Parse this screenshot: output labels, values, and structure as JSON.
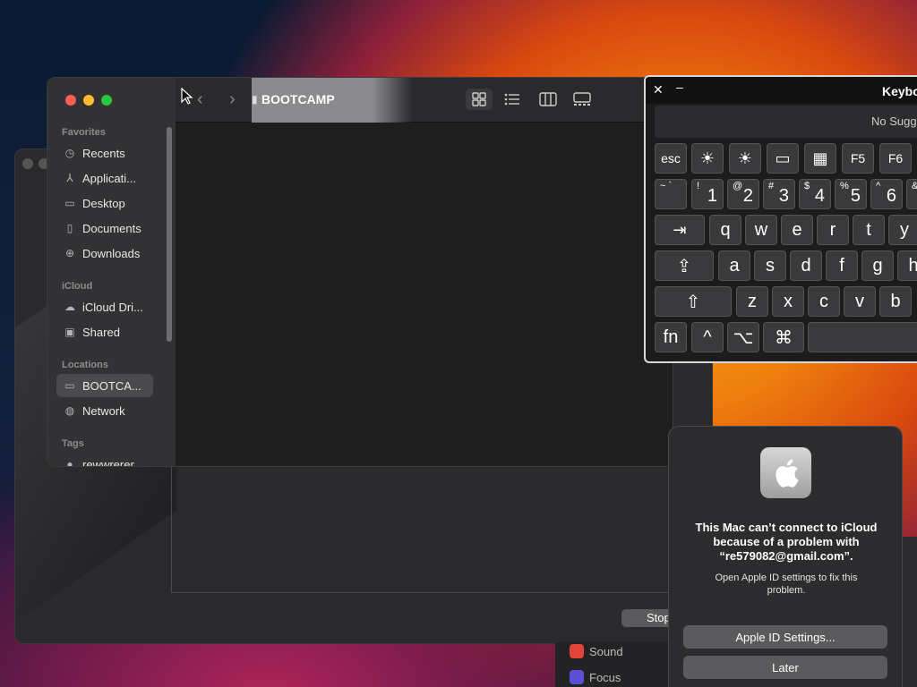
{
  "finder": {
    "title": "BOOTCAMP",
    "sidebar": {
      "favorites_label": "Favorites",
      "favorites": [
        {
          "label": "Recents",
          "icon": "clock-icon"
        },
        {
          "label": "Applicati...",
          "icon": "applications-icon"
        },
        {
          "label": "Desktop",
          "icon": "desktop-icon"
        },
        {
          "label": "Documents",
          "icon": "document-icon"
        },
        {
          "label": "Downloads",
          "icon": "download-icon"
        }
      ],
      "icloud_label": "iCloud",
      "icloud": [
        {
          "label": "iCloud Dri...",
          "icon": "cloud-icon"
        },
        {
          "label": "Shared",
          "icon": "shared-folder-icon"
        }
      ],
      "locations_label": "Locations",
      "locations": [
        {
          "label": "BOOTCA...",
          "icon": "drive-icon",
          "selected": true
        },
        {
          "label": "Network",
          "icon": "globe-icon"
        }
      ],
      "tags_label": "Tags",
      "tags": [
        {
          "label": "rewwrerer",
          "icon": "tag-dot-icon"
        }
      ]
    }
  },
  "keyboard": {
    "title": "Keybo",
    "suggestion": "No Sugge",
    "function_row": [
      "esc",
      "☀",
      "☀",
      "▭",
      "▦",
      "F5",
      "F6"
    ],
    "number_row": [
      {
        "sub": "~ `",
        "main": ""
      },
      {
        "sub": "!",
        "main": "1"
      },
      {
        "sub": "@",
        "main": "2"
      },
      {
        "sub": "#",
        "main": "3"
      },
      {
        "sub": "$",
        "main": "4"
      },
      {
        "sub": "%",
        "main": "5"
      },
      {
        "sub": "^",
        "main": "6"
      },
      {
        "sub": "&",
        "main": ""
      }
    ],
    "row_q": [
      "⇥",
      "q",
      "w",
      "e",
      "r",
      "t",
      "y"
    ],
    "row_a": [
      "⇪",
      "a",
      "s",
      "d",
      "f",
      "g",
      "h"
    ],
    "row_z": [
      "⇧",
      "z",
      "x",
      "c",
      "v",
      "b"
    ],
    "row_mod": [
      "fn",
      "^",
      "⌥",
      "⌘"
    ]
  },
  "alert": {
    "title": "This Mac can’t connect to iCloud because of a problem with “re579082@gmail.com”.",
    "body": "Open Apple ID settings to fix this problem.",
    "primary_button": "Apple ID Settings...",
    "secondary_button": "Later"
  },
  "background": {
    "stop_button": "Stop",
    "settings_items": [
      "Sound",
      "Focus"
    ]
  },
  "colors": {
    "traffic_close": "#ff5f57",
    "traffic_minimize": "#febc2e",
    "traffic_zoom": "#28c840"
  }
}
